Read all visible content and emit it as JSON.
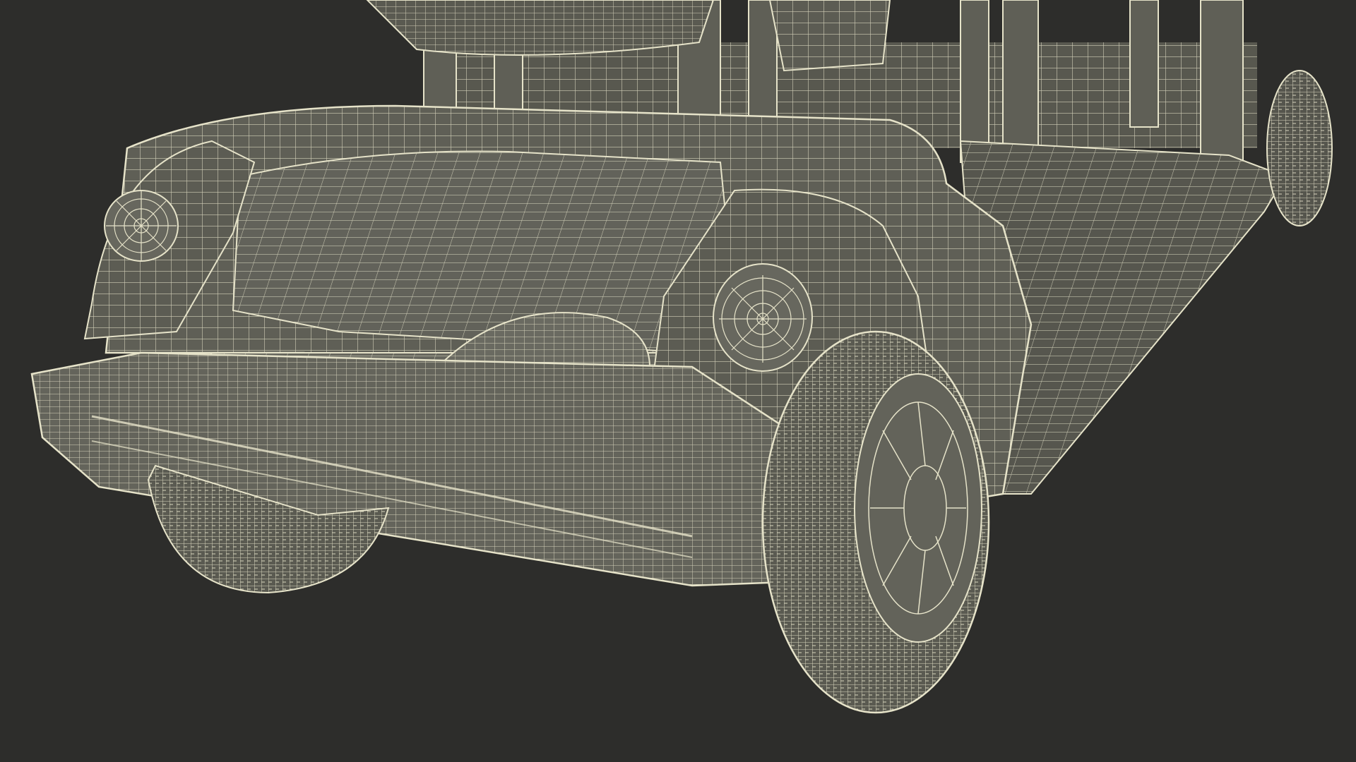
{
  "scene": {
    "background_color": "#2d2d2b",
    "surface_color": "#5f5f56",
    "surface_dark_color": "#4c4c45",
    "wire_color": "#e6e3c9",
    "subject": "wireframe-golf-cart-rear-view"
  }
}
